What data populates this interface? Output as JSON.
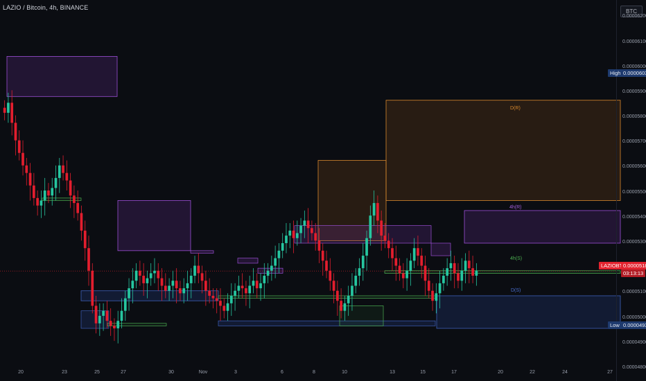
{
  "chart_header": {
    "title": "LAZIO / Bitcoin, 4h, BINANCE",
    "quote_currency": "BTC"
  },
  "price_axis": {
    "ticks": [
      "0.00006200",
      "0.00006100",
      "0.00006000",
      "0.00005900",
      "0.00005800",
      "0.00005700",
      "0.00005600",
      "0.00005500",
      "0.00005400",
      "0.00005300",
      "0.00005100",
      "0.00005000",
      "0.00004900",
      "0.00004800"
    ]
  },
  "time_axis": {
    "ticks": [
      "20",
      "23",
      "25",
      "27",
      "30",
      "Nov",
      "3",
      "6",
      "8",
      "10",
      "13",
      "15",
      "17",
      "20",
      "22",
      "24",
      "27"
    ]
  },
  "markers": {
    "high_label": "High",
    "high_value": "0.00006032",
    "low_label": "Low",
    "low_value": "0.00004931",
    "symbol": "LAZIOBTC",
    "current_value": "0.00005189",
    "countdown": "03:13:13"
  },
  "zone_labels": {
    "d_r": "D(R)",
    "four_h_r": "4h(R)",
    "four_h_s": "4h(S)",
    "d_s": "D(S)"
  },
  "colors": {
    "background": "#0b0d12",
    "bull_candle": "#26c6a0",
    "bear_candle": "#e31e2e",
    "resistance_4h": "#9c4fd6",
    "resistance_d": "#d9892e",
    "support_4h": "#4caf50",
    "support_d": "#3e5fb8",
    "price_line": "#e3232f"
  },
  "chart_data": {
    "type": "candlestick",
    "symbol": "LAZIO / Bitcoin",
    "interval": "4h",
    "exchange": "BINANCE",
    "price_range": [
      4.75e-05,
      6.27e-05
    ],
    "current_price": 5.189e-05,
    "high": 6.032e-05,
    "low": 4.931e-05,
    "close_series": [
      5.82e-05,
      5.86e-05,
      5.78e-05,
      5.71e-05,
      5.66e-05,
      5.61e-05,
      5.58e-05,
      5.53e-05,
      5.48e-05,
      5.45e-05,
      5.47e-05,
      5.51e-05,
      5.49e-05,
      5.52e-05,
      5.56e-05,
      5.61e-05,
      5.58e-05,
      5.55e-05,
      5.49e-05,
      5.46e-05,
      5.42e-05,
      5.35e-05,
      5.28e-05,
      5.19e-05,
      5.05e-05,
      4.98e-05,
      5.01e-05,
      5.03e-05,
      4.99e-05,
      4.97e-05,
      4.96e-05,
      4.99e-05,
      5.03e-05,
      5.08e-05,
      5.12e-05,
      5.15e-05,
      5.19e-05,
      5.17e-05,
      5.14e-05,
      5.16e-05,
      5.18e-05,
      5.19e-05,
      5.16e-05,
      5.13e-05,
      5.11e-05,
      5.13e-05,
      5.15e-05,
      5.12e-05,
      5.1e-05,
      5.12e-05,
      5.14e-05,
      5.17e-05,
      5.21e-05,
      5.18e-05,
      5.15e-05,
      5.11e-05,
      5.09e-05,
      5.08e-05,
      5.07e-05,
      5.05e-05,
      5.03e-05,
      5.06e-05,
      5.09e-05,
      5.11e-05,
      5.13e-05,
      5.12e-05,
      5.1e-05,
      5.13e-05,
      5.15e-05,
      5.12e-05,
      5.14e-05,
      5.17e-05,
      5.19e-05,
      5.21e-05,
      5.24e-05,
      5.27e-05,
      5.3e-05,
      5.33e-05,
      5.35e-05,
      5.32e-05,
      5.34e-05,
      5.37e-05,
      5.39e-05,
      5.36e-05,
      5.34e-05,
      5.31e-05,
      5.27e-05,
      5.23e-05,
      5.19e-05,
      5.15e-05,
      5.11e-05,
      5.07e-05,
      5.03e-05,
      5.06e-05,
      5.09e-05,
      5.13e-05,
      5.17e-05,
      5.2e-05,
      5.25e-05,
      5.32e-05,
      5.41e-05,
      5.46e-05,
      5.39e-05,
      5.33e-05,
      5.31e-05,
      5.28e-05,
      5.24e-05,
      5.21e-05,
      5.18e-05,
      5.16e-05,
      5.19e-05,
      5.23e-05,
      5.28e-05,
      5.25e-05,
      5.21e-05,
      5.15e-05,
      5.11e-05,
      5.07e-05,
      5.1e-05,
      5.14e-05,
      5.17e-05,
      5.2e-05,
      5.22e-05,
      5.18e-05,
      5.15e-05,
      5.19e-05,
      5.23e-05,
      5.2e-05,
      5.17e-05,
      5.19e-05
    ],
    "zones": [
      {
        "kind": "4h(R)",
        "from": 5.885e-05,
        "to": 6.045e-05
      },
      {
        "kind": "4h(R)",
        "from": 5.27e-05,
        "to": 5.47e-05
      },
      {
        "kind": "D(R)",
        "from": 5.31e-05,
        "to": 5.63e-05
      },
      {
        "kind": "D(R)",
        "from": 5.47e-05,
        "to": 5.87e-05
      },
      {
        "kind": "4h(R)",
        "from": 5.3e-05,
        "to": 5.43e-05
      },
      {
        "kind": "4h(S)",
        "from": 5.18e-05,
        "to": 5.19e-05
      },
      {
        "kind": "D(S)",
        "from": 4.96e-05,
        "to": 5.09e-05
      },
      {
        "kind": "D(S)",
        "from": 5.07e-05,
        "to": 5.11e-05
      }
    ]
  }
}
